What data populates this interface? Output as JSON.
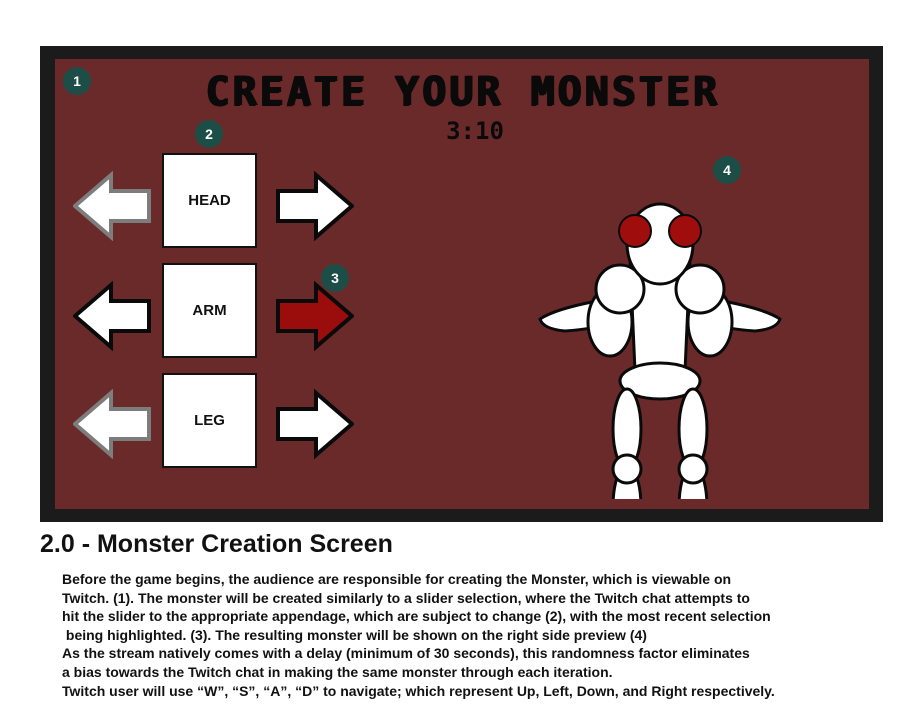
{
  "game": {
    "title": "CREATE YOUR MONSTER",
    "timer": "3:10",
    "badges": [
      "1",
      "2",
      "3",
      "4"
    ],
    "parts": [
      {
        "label": "HEAD",
        "left_arrow_state": "disabled",
        "right_arrow_state": "normal"
      },
      {
        "label": "ARM",
        "left_arrow_state": "normal",
        "right_arrow_state": "highlighted"
      },
      {
        "label": "LEG",
        "left_arrow_state": "disabled",
        "right_arrow_state": "normal"
      }
    ],
    "colors": {
      "background": "#6b2a2a",
      "frame": "#1b1b1b",
      "highlight_arrow": "#9b0d0d",
      "badge": "#1c4e47",
      "monster_eye": "#a00d0d"
    }
  },
  "doc": {
    "heading": "2.0 - Monster Creation Screen",
    "lines": [
      "Before the game begins, the audience are responsible for creating the Monster, which is viewable on",
      "Twitch. (1). The monster will be created similarly to a slider selection, where the Twitch chat attempts to",
      "hit the slider to the appropriate appendage, which are subject to change (2), with the most recent selection",
      " being highlighted. (3). The resulting monster will be shown on the right side preview (4)",
      "As the stream natively comes with a delay (minimum of 30 seconds), this randomness factor eliminates",
      "a bias towards the Twitch chat in making the same monster through each iteration.",
      "Twitch user will use “W”, “S”, “A”, “D” to navigate; which represent Up, Left, Down, and Right respectively."
    ]
  }
}
